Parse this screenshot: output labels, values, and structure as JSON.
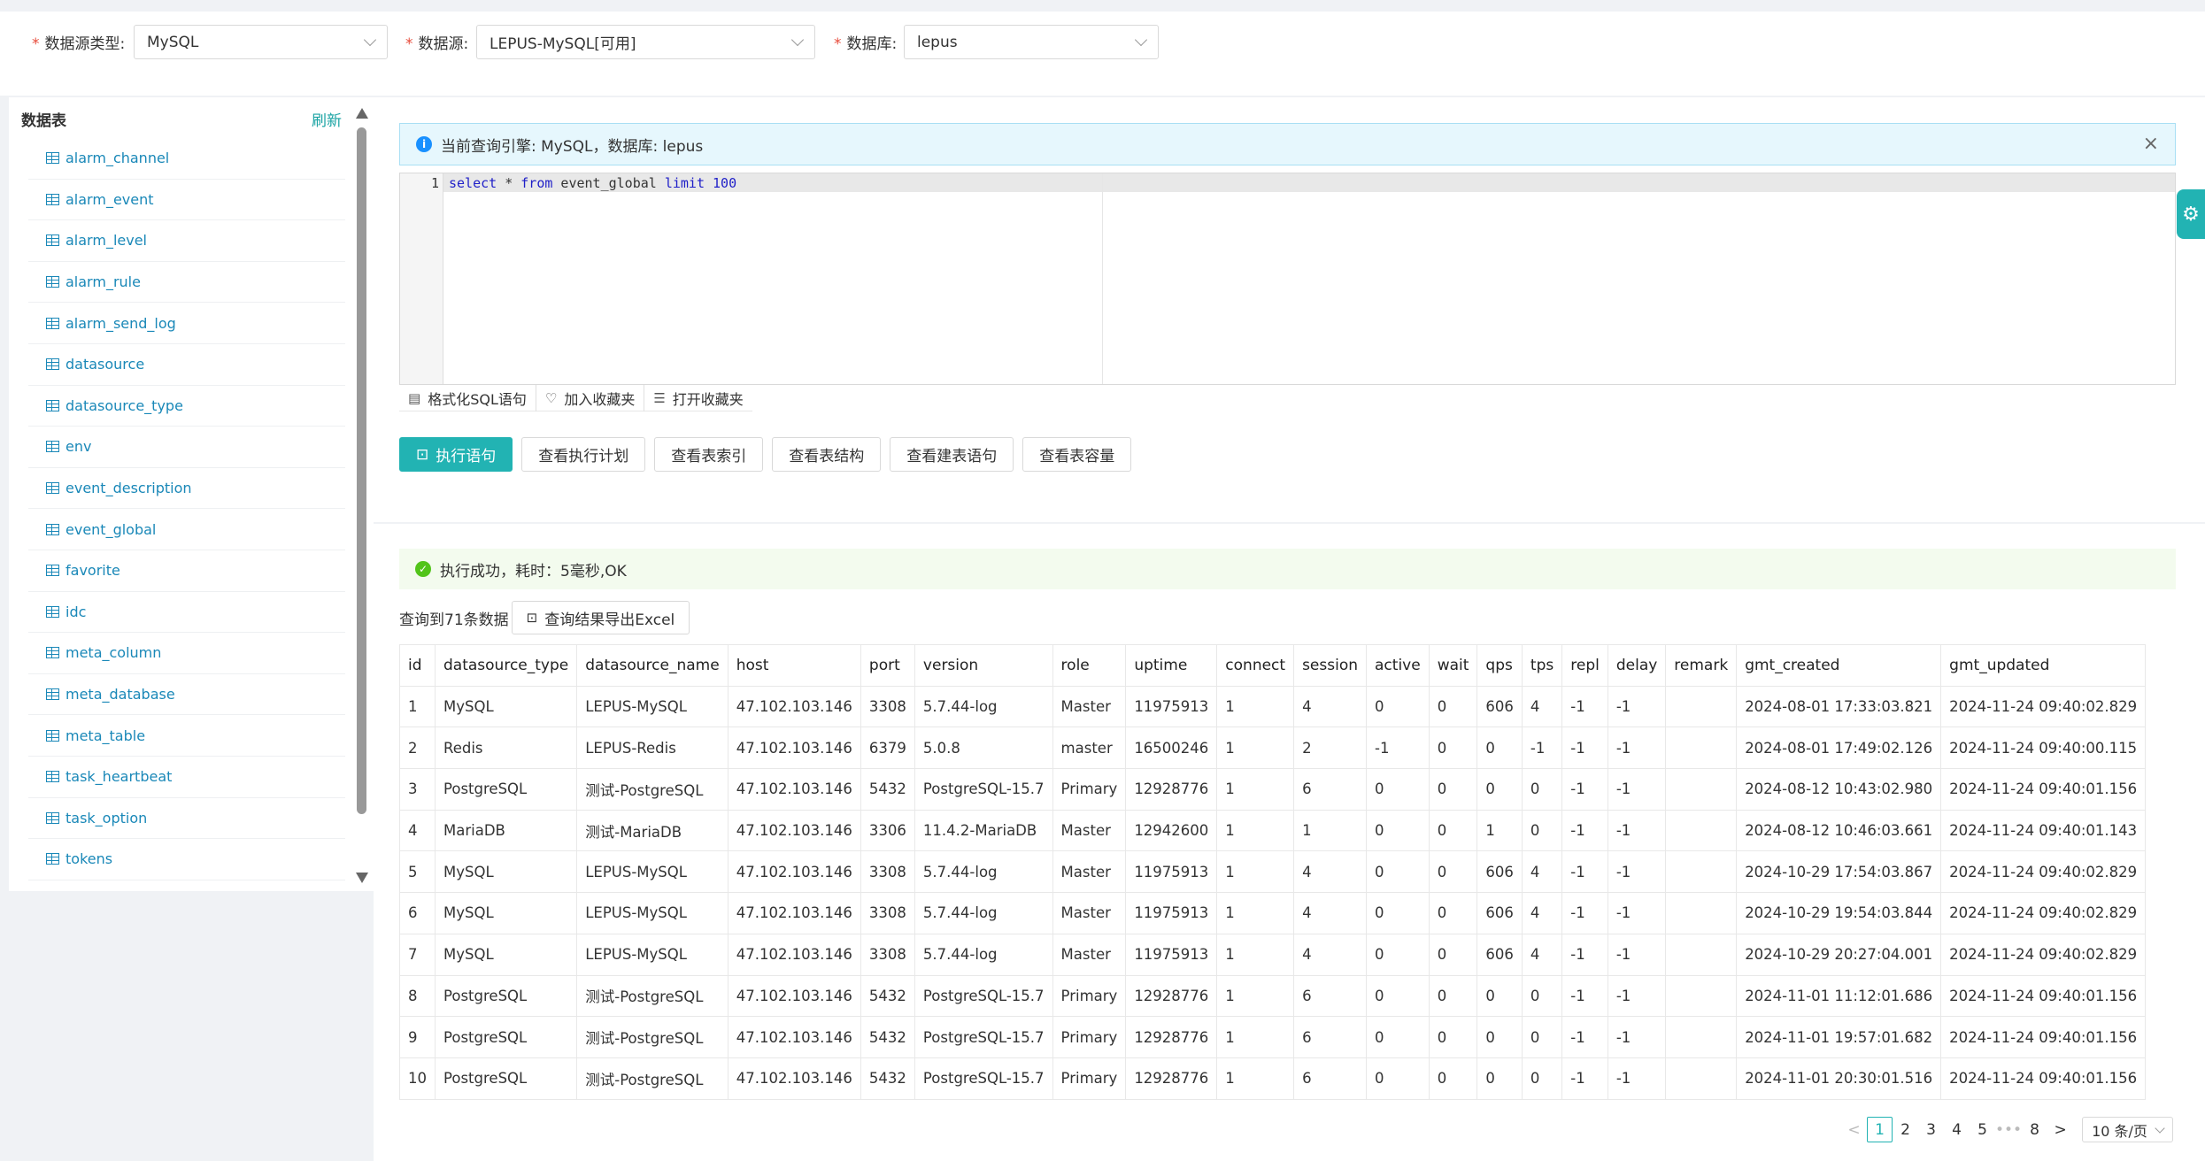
{
  "filters": {
    "dstype_label": "数据源类型:",
    "dstype_value": "MySQL",
    "datasource_label": "数据源:",
    "datasource_value": "LEPUS-MySQL[可用]",
    "database_label": "数据库:",
    "database_value": "lepus"
  },
  "sidebar": {
    "title": "数据表",
    "refresh": "刷新",
    "tables": [
      "alarm_channel",
      "alarm_event",
      "alarm_level",
      "alarm_rule",
      "alarm_send_log",
      "datasource",
      "datasource_type",
      "env",
      "event_description",
      "event_global",
      "favorite",
      "idc",
      "meta_column",
      "meta_database",
      "meta_table",
      "task_heartbeat",
      "task_option",
      "tokens"
    ]
  },
  "alert": {
    "text": "当前查询引擎: MySQL，数据库: lepus",
    "close": "×"
  },
  "editor": {
    "line_number": "1",
    "kw_select": "select",
    "star": " * ",
    "kw_from": "from",
    "table": " event_global ",
    "kw_limit": "limit",
    "limit_value": " 100"
  },
  "editor_toolbar": {
    "format": "格式化SQL语句",
    "add_fav": "加入收藏夹",
    "open_fav": "打开收藏夹"
  },
  "actions": {
    "execute": "执行语句",
    "plan": "查看执行计划",
    "index": "查看表索引",
    "structure": "查看表结构",
    "create_stmt": "查看建表语句",
    "capacity": "查看表容量"
  },
  "result": {
    "status": "执行成功，耗时：5毫秒,OK",
    "count": "查询到71条数据",
    "export": "查询结果导出Excel",
    "columns": [
      "id",
      "datasource_type",
      "datasource_name",
      "host",
      "port",
      "version",
      "role",
      "uptime",
      "connect",
      "session",
      "active",
      "wait",
      "qps",
      "tps",
      "repl",
      "delay",
      "remark",
      "gmt_created",
      "gmt_updated"
    ],
    "rows": [
      [
        "1",
        "MySQL",
        "LEPUS-MySQL",
        "47.102.103.146",
        "3308",
        "5.7.44-log",
        "Master",
        "11975913",
        "1",
        "4",
        "0",
        "0",
        "606",
        "4",
        "-1",
        "-1",
        "",
        "2024-08-01 17:33:03.821",
        "2024-11-24 09:40:02.829"
      ],
      [
        "2",
        "Redis",
        "LEPUS-Redis",
        "47.102.103.146",
        "6379",
        "5.0.8",
        "master",
        "16500246",
        "1",
        "2",
        "-1",
        "0",
        "0",
        "-1",
        "-1",
        "-1",
        "",
        "2024-08-01 17:49:02.126",
        "2024-11-24 09:40:00.115"
      ],
      [
        "3",
        "PostgreSQL",
        "测试-PostgreSQL",
        "47.102.103.146",
        "5432",
        "PostgreSQL-15.7",
        "Primary",
        "12928776",
        "1",
        "6",
        "0",
        "0",
        "0",
        "0",
        "-1",
        "-1",
        "",
        "2024-08-12 10:43:02.980",
        "2024-11-24 09:40:01.156"
      ],
      [
        "4",
        "MariaDB",
        "测试-MariaDB",
        "47.102.103.146",
        "3306",
        "11.4.2-MariaDB",
        "Master",
        "12942600",
        "1",
        "1",
        "0",
        "0",
        "1",
        "0",
        "-1",
        "-1",
        "",
        "2024-08-12 10:46:03.661",
        "2024-11-24 09:40:01.143"
      ],
      [
        "5",
        "MySQL",
        "LEPUS-MySQL",
        "47.102.103.146",
        "3308",
        "5.7.44-log",
        "Master",
        "11975913",
        "1",
        "4",
        "0",
        "0",
        "606",
        "4",
        "-1",
        "-1",
        "",
        "2024-10-29 17:54:03.867",
        "2024-11-24 09:40:02.829"
      ],
      [
        "6",
        "MySQL",
        "LEPUS-MySQL",
        "47.102.103.146",
        "3308",
        "5.7.44-log",
        "Master",
        "11975913",
        "1",
        "4",
        "0",
        "0",
        "606",
        "4",
        "-1",
        "-1",
        "",
        "2024-10-29 19:54:03.844",
        "2024-11-24 09:40:02.829"
      ],
      [
        "7",
        "MySQL",
        "LEPUS-MySQL",
        "47.102.103.146",
        "3308",
        "5.7.44-log",
        "Master",
        "11975913",
        "1",
        "4",
        "0",
        "0",
        "606",
        "4",
        "-1",
        "-1",
        "",
        "2024-10-29 20:27:04.001",
        "2024-11-24 09:40:02.829"
      ],
      [
        "8",
        "PostgreSQL",
        "测试-PostgreSQL",
        "47.102.103.146",
        "5432",
        "PostgreSQL-15.7",
        "Primary",
        "12928776",
        "1",
        "6",
        "0",
        "0",
        "0",
        "0",
        "-1",
        "-1",
        "",
        "2024-11-01 11:12:01.686",
        "2024-11-24 09:40:01.156"
      ],
      [
        "9",
        "PostgreSQL",
        "测试-PostgreSQL",
        "47.102.103.146",
        "5432",
        "PostgreSQL-15.7",
        "Primary",
        "12928776",
        "1",
        "6",
        "0",
        "0",
        "0",
        "0",
        "-1",
        "-1",
        "",
        "2024-11-01 19:57:01.682",
        "2024-11-24 09:40:01.156"
      ],
      [
        "10",
        "PostgreSQL",
        "测试-PostgreSQL",
        "47.102.103.146",
        "5432",
        "PostgreSQL-15.7",
        "Primary",
        "12928776",
        "1",
        "6",
        "0",
        "0",
        "0",
        "0",
        "-1",
        "-1",
        "",
        "2024-11-01 20:30:01.516",
        "2024-11-24 09:40:01.156"
      ]
    ]
  },
  "pagination": {
    "prev": "<",
    "pages": [
      "1",
      "2",
      "3",
      "4",
      "5"
    ],
    "ellipsis": "•••",
    "last": "8",
    "next": ">",
    "page_size": "10 条/页"
  },
  "icons": {
    "info": "info-icon",
    "success": "check-circle-icon",
    "table": "table-icon",
    "settings": "gear-icon"
  },
  "colors": {
    "accent": "#22b3b3",
    "link": "#1a88b8",
    "required": "#e74c3c",
    "info": "#1890ff",
    "success": "#52c41a"
  }
}
